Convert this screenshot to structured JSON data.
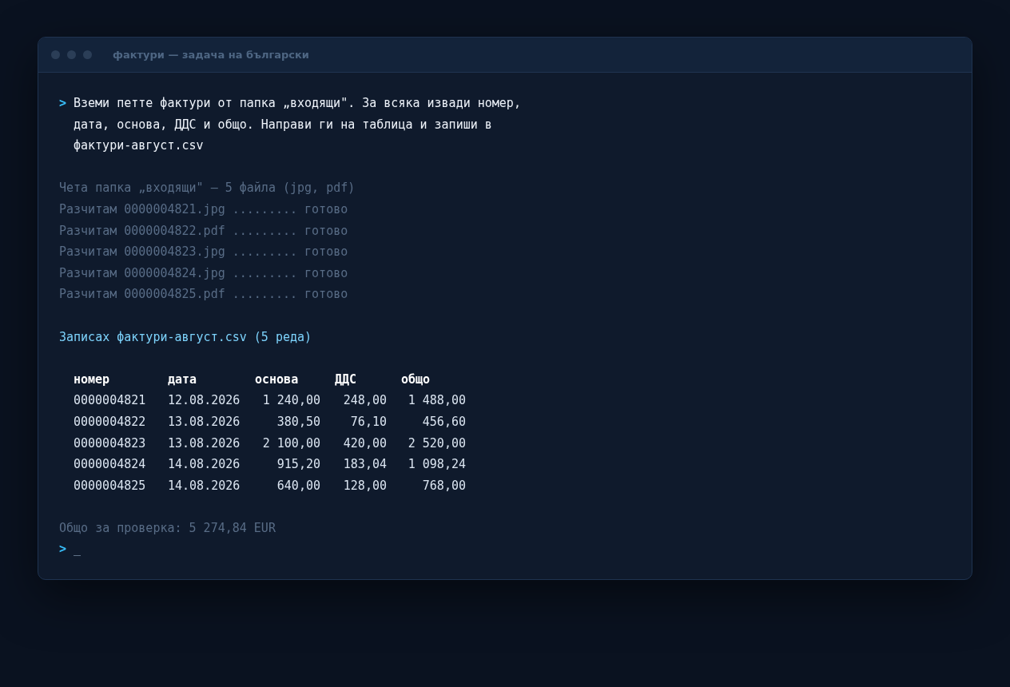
{
  "window": {
    "title": "фактури — задача на български"
  },
  "prompt": {
    "symbol": ">",
    "lines": [
      "Вземи петте фактури от папка „входящи\". За всяка извади номер,",
      "дата, основа, ДДС и общо. Направи ги на таблица и запиши в",
      "фактури-август.csv"
    ]
  },
  "log": [
    "Чета папка „входящи\" — 5 файла (jpg, pdf)",
    "Разчитам 0000004821.jpg ......... готово",
    "Разчитам 0000004822.pdf ......... готово",
    "Разчитам 0000004823.jpg ......... готово",
    "Разчитам 0000004824.jpg ......... готово",
    "Разчитам 0000004825.pdf ......... готово"
  ],
  "result": "Записах фактури-август.csv (5 реда)",
  "table": {
    "columns": [
      "номер",
      "дата",
      "основа",
      "ДДС",
      "общо"
    ],
    "rows": [
      [
        "0000004821",
        "12.08.2026",
        "1 240,00",
        "248,00",
        "1 488,00"
      ],
      [
        "0000004822",
        "13.08.2026",
        "380,50",
        "76,10",
        "456,60"
      ],
      [
        "0000004823",
        "13.08.2026",
        "2 100,00",
        "420,00",
        "2 520,00"
      ],
      [
        "0000004824",
        "14.08.2026",
        "915,20",
        "183,04",
        "1 098,24"
      ],
      [
        "0000004825",
        "14.08.2026",
        "640,00",
        "128,00",
        "768,00"
      ]
    ]
  },
  "summary": "Общо за проверка: 5 274,84 EUR",
  "input": {
    "symbol": ">",
    "value": "_"
  }
}
